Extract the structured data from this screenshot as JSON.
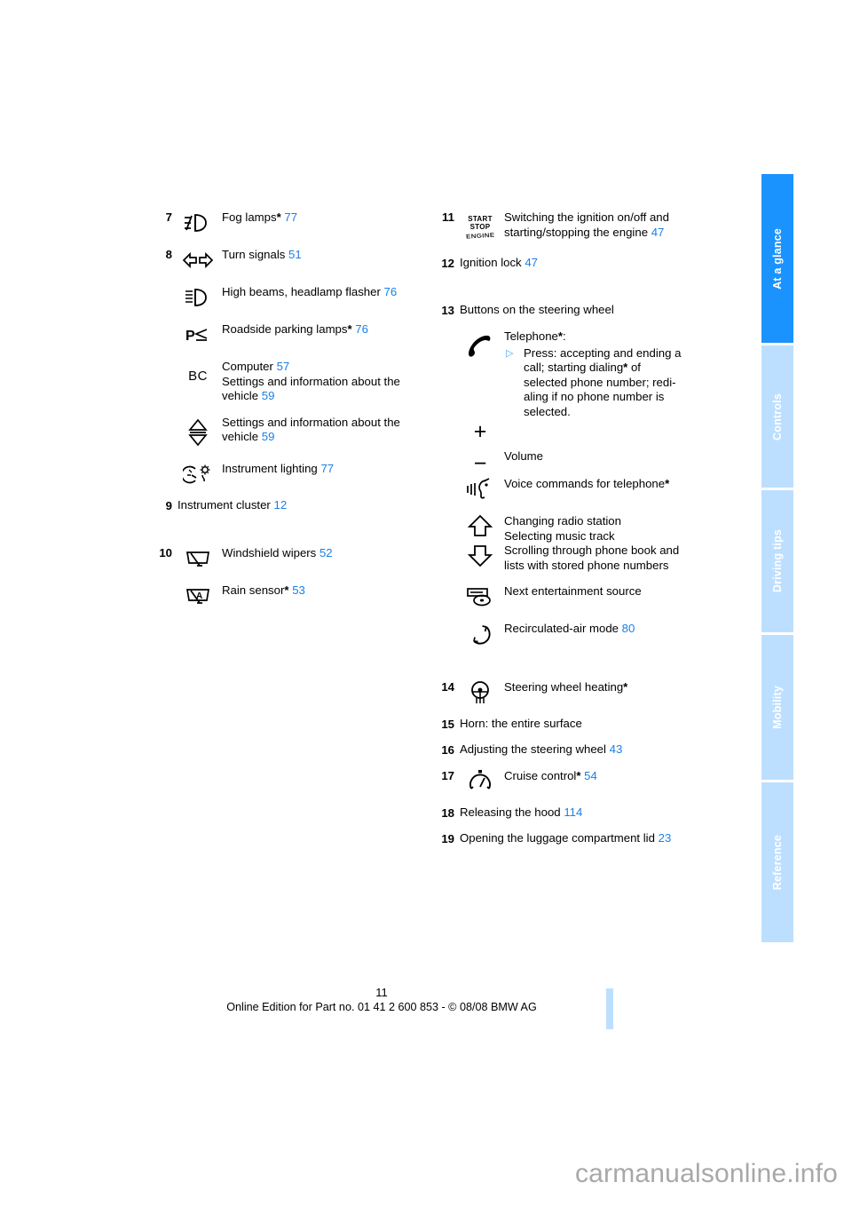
{
  "document": {
    "page_number": "11",
    "footer_note": "Online Edition for Part no. 01 41 2 600 853 - © 08/08 BMW AG",
    "watermark": "carmanualsonline.info"
  },
  "colors": {
    "tab_active": "#1a93ff",
    "tab_inactive": "#bddfff",
    "page_reference_link": "#1a7fe8",
    "bullet_marker": "#4aa3ef"
  },
  "tabs": [
    {
      "label": "At a glance",
      "active": true
    },
    {
      "label": "Controls",
      "active": false
    },
    {
      "label": "Driving tips",
      "active": false
    },
    {
      "label": "Mobility",
      "active": false
    },
    {
      "label": "Reference",
      "active": false
    }
  ],
  "left_column": {
    "item7": {
      "number": "7",
      "icon": "fog-lamp-icon",
      "label": "Fog lamps",
      "star": "*",
      "page": "77"
    },
    "item8": {
      "number": "8",
      "sub": [
        {
          "icon": "turn-signal-icon",
          "label": "Turn signals",
          "star": "",
          "page": "51"
        },
        {
          "icon": "high-beam-icon",
          "label": "High beams, headlamp flasher",
          "star": "",
          "page": "76"
        },
        {
          "icon": "roadside-parking-lamp-icon",
          "label": "Roadside parking lamps",
          "star": "*",
          "page": "76"
        },
        {
          "icon": "bc-computer-icon",
          "label": "Computer",
          "star": "",
          "page": "57",
          "line2": "Settings and information about the",
          "line3": "vehicle",
          "page2": "59"
        },
        {
          "icon": "up-down-triangle-icon",
          "label": "Settings and information about the",
          "line3": "vehicle",
          "star": "",
          "page": "59"
        },
        {
          "icon": "instrument-lighting-icon",
          "label": "Instrument lighting",
          "star": "",
          "page": "77"
        }
      ]
    },
    "item9": {
      "number": "9",
      "label": "Instrument cluster",
      "page": "12"
    },
    "item10": {
      "number": "10",
      "sub": [
        {
          "icon": "windshield-wiper-icon",
          "label": "Windshield wipers",
          "star": "",
          "page": "52"
        },
        {
          "icon": "rain-sensor-icon",
          "label": "Rain sensor",
          "star": "*",
          "page": "53"
        }
      ]
    }
  },
  "right_column": {
    "item11": {
      "number": "11",
      "icon": "start-stop-engine-icon",
      "icon_text_line1": "START",
      "icon_text_line2": "STOP",
      "icon_text_line3": "ENGINE",
      "label_line1": "Switching the ignition on/off and",
      "label_line2": "starting/stopping the engine",
      "page": "47"
    },
    "item12": {
      "number": "12",
      "label": "Ignition lock",
      "page": "47"
    },
    "item13": {
      "number": "13",
      "label": "Buttons on the steering wheel",
      "sub": [
        {
          "icon": "telephone-icon",
          "label": "Telephone",
          "star": "*",
          "colon": ":",
          "bullets": [
            {
              "marker": "▷",
              "line1": "Press: accepting and ending a",
              "line2": "call; starting dialing",
              "star": "*",
              "line2b": " of",
              "line3": "selected phone number; redi-",
              "line4": "aling if no phone number is",
              "line5": "selected."
            }
          ]
        },
        {
          "icon": "volume-plus-minus-icon",
          "label": "Volume",
          "star": "",
          "page": ""
        },
        {
          "icon": "voice-command-icon",
          "label": "Voice commands for telephone",
          "star": "*",
          "page": ""
        },
        {
          "icon": "up-down-arrows-icon",
          "label_lines": [
            "Changing radio station",
            "Selecting music track",
            "Scrolling through phone book and",
            "lists with stored phone numbers"
          ]
        },
        {
          "icon": "entertainment-source-icon",
          "label": "Next entertainment source",
          "star": "",
          "page": ""
        },
        {
          "icon": "recirculated-air-icon",
          "label": "Recirculated-air mode",
          "star": "",
          "page": "80"
        }
      ]
    },
    "item14": {
      "number": "14",
      "icon": "steering-wheel-heating-icon",
      "label": "Steering wheel heating",
      "star": "*",
      "page": ""
    },
    "item15": {
      "number": "15",
      "label": "Horn: the entire surface",
      "page": ""
    },
    "item16": {
      "number": "16",
      "label": "Adjusting the steering wheel",
      "page": "43"
    },
    "item17": {
      "number": "17",
      "icon": "cruise-control-icon",
      "label": "Cruise control",
      "star": "*",
      "page": "54"
    },
    "item18": {
      "number": "18",
      "label": "Releasing the hood",
      "page": "114"
    },
    "item19": {
      "number": "19",
      "label": "Opening the luggage compartment lid",
      "page": "23"
    }
  }
}
